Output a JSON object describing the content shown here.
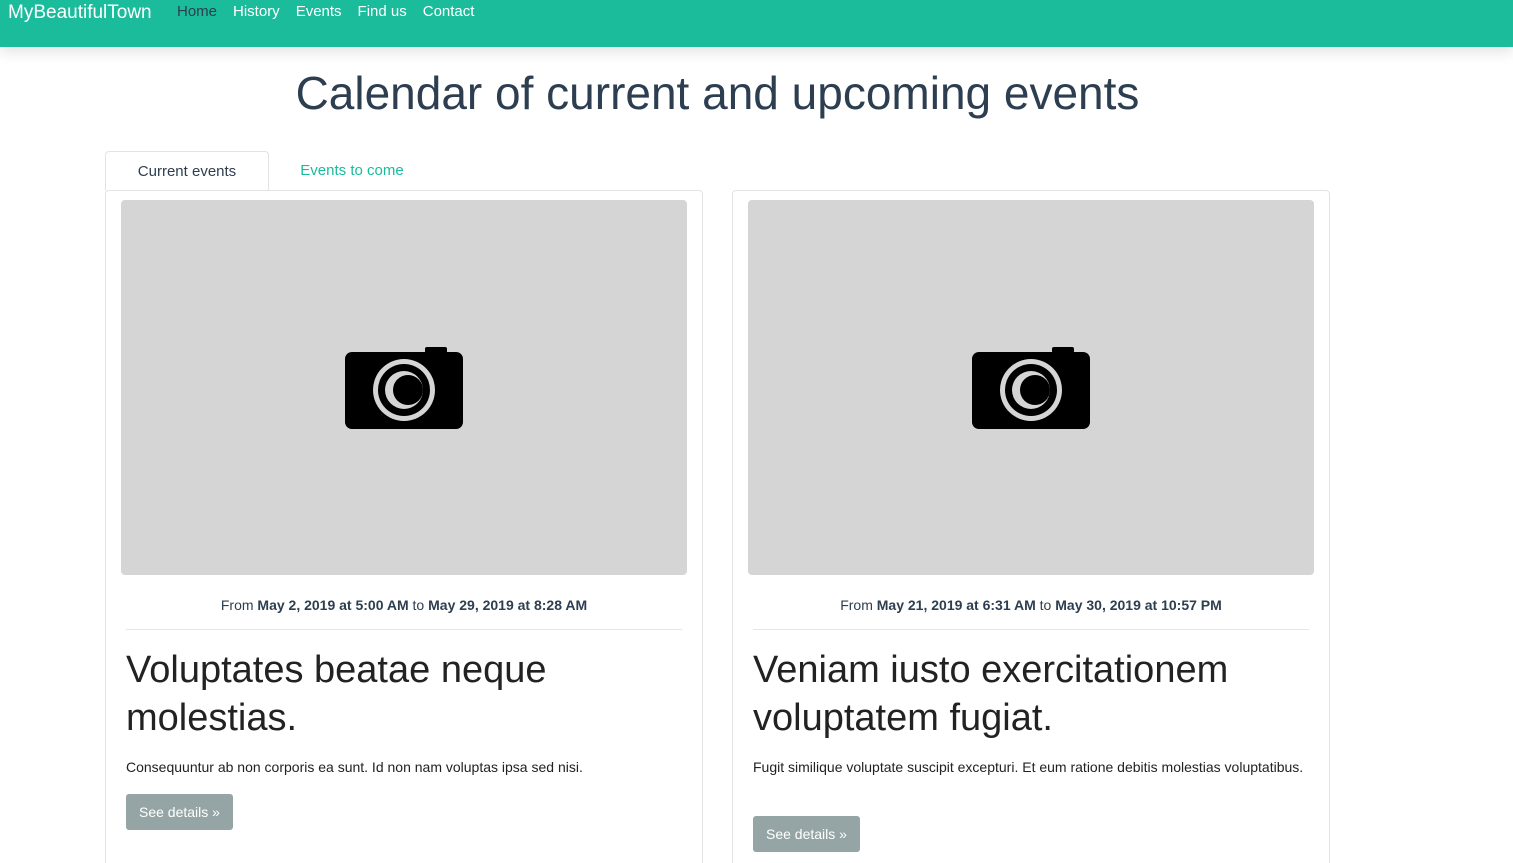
{
  "navbar": {
    "brand": "MyBeautifulTown",
    "links": [
      "Home",
      "History",
      "Events",
      "Find us",
      "Contact"
    ],
    "active": "Home"
  },
  "page": {
    "title": "Calendar of current and upcoming events"
  },
  "tabs": {
    "current": "Current events",
    "upcoming": "Events to come"
  },
  "colors": {
    "accent": "#1abc9c",
    "text": "#2c3e50",
    "button": "#95a5a6",
    "placeholder": "#d5d5d5"
  },
  "events": [
    {
      "icon": "camera-icon",
      "from_label": "From",
      "start": "May 2, 2019 at 5:00 AM",
      "to_label": "to",
      "end": "May 29, 2019 at 8:28 AM",
      "title": "Voluptates beatae neque molestias.",
      "description": "Consequuntur ab non corporis ea sunt. Id non nam voluptas ipsa sed nisi.",
      "button": "See details »"
    },
    {
      "icon": "camera-icon",
      "from_label": "From",
      "start": "May 21, 2019 at 6:31 AM",
      "to_label": "to",
      "end": "May 30, 2019 at 10:57 PM",
      "title": "Veniam iusto exercitationem voluptatem fugiat.",
      "description": "Fugit similique voluptate suscipit excepturi. Et eum ratione debitis molestias voluptatibus.",
      "button": "See details »"
    }
  ]
}
